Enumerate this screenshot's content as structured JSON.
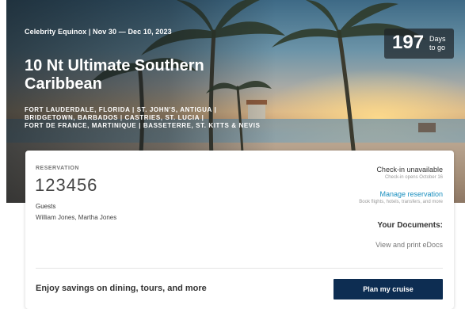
{
  "cruise": {
    "ship_dates": "Celebrity Equinox | Nov 30 — Dec 10, 2023",
    "title": "10 Nt Ultimate Southern Caribbean",
    "ports_line1": "Fort Lauderdale, Florida | St. John's, Antigua |",
    "ports_line2": "Bridgetown, Barbados | Castries, St. Lucia |",
    "ports_line3": "Fort de France, Martinique | Basseterre, St. Kitts & Nevis"
  },
  "countdown": {
    "value": "197",
    "unit_line1": "Days",
    "unit_line2": "to go"
  },
  "reservation": {
    "label": "RESERVATION",
    "number": "123456",
    "guests_label": "Guests",
    "guests": "William Jones, Martha Jones"
  },
  "checkin": {
    "status": "Check-in unavailable",
    "note": "Check-in opens October 16"
  },
  "manage": {
    "label": "Manage reservation",
    "note": "Book flights, hotels, transfers, and more"
  },
  "documents": {
    "heading": "Your Documents:",
    "link": "View and print eDocs"
  },
  "promo": {
    "text": "Enjoy savings on dining, tours, and more",
    "button": "Plan my cruise"
  },
  "colors": {
    "accent_link": "#1a8fbf",
    "primary_button": "#0d2d52"
  }
}
